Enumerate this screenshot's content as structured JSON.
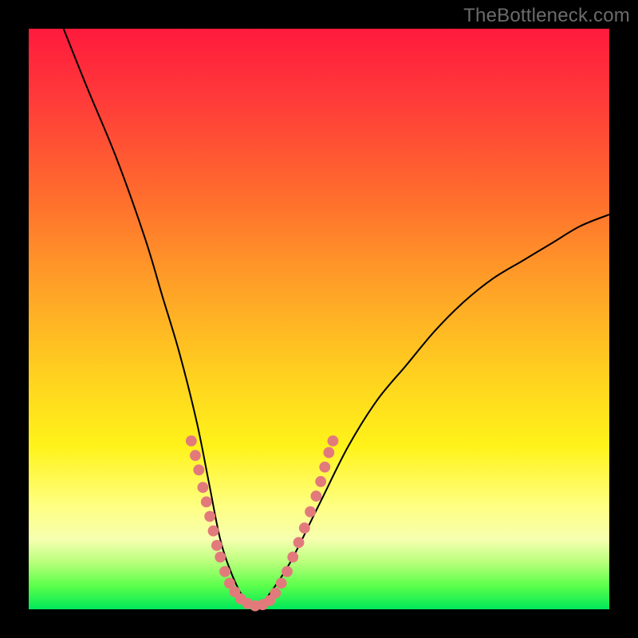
{
  "watermark": "TheBottleneck.com",
  "colors": {
    "curve": "#000000",
    "marker": "#e27a7c",
    "background_black": "#000000"
  },
  "chart_data": {
    "type": "line",
    "title": "",
    "xlabel": "",
    "ylabel": "",
    "xlim": [
      0,
      100
    ],
    "ylim": [
      0,
      100
    ],
    "grid": false,
    "legend": false,
    "series": [
      {
        "name": "bottleneck-curve",
        "x": [
          6,
          10,
          15,
          20,
          23,
          26,
          29,
          31,
          33,
          35,
          37,
          39,
          41,
          45,
          50,
          55,
          60,
          65,
          70,
          75,
          80,
          85,
          90,
          95,
          100
        ],
        "y": [
          100,
          90,
          78,
          64,
          54,
          44,
          32,
          22,
          12,
          6,
          2,
          0,
          2,
          8,
          18,
          28,
          36,
          42,
          48,
          53,
          57,
          60,
          63,
          66,
          68
        ]
      }
    ],
    "markers": [
      {
        "name": "highlight-dots",
        "points": [
          {
            "x": 28.0,
            "y": 29.0
          },
          {
            "x": 28.7,
            "y": 26.5
          },
          {
            "x": 29.3,
            "y": 24.0
          },
          {
            "x": 30.0,
            "y": 21.0
          },
          {
            "x": 30.6,
            "y": 18.5
          },
          {
            "x": 31.2,
            "y": 16.0
          },
          {
            "x": 31.8,
            "y": 13.5
          },
          {
            "x": 32.4,
            "y": 11.0
          },
          {
            "x": 33.0,
            "y": 9.0
          },
          {
            "x": 33.8,
            "y": 6.5
          },
          {
            "x": 34.6,
            "y": 4.5
          },
          {
            "x": 35.5,
            "y": 3.0
          },
          {
            "x": 36.5,
            "y": 1.8
          },
          {
            "x": 37.7,
            "y": 1.0
          },
          {
            "x": 39.0,
            "y": 0.6
          },
          {
            "x": 40.3,
            "y": 0.8
          },
          {
            "x": 41.5,
            "y": 1.5
          },
          {
            "x": 42.5,
            "y": 2.8
          },
          {
            "x": 43.5,
            "y": 4.5
          },
          {
            "x": 44.5,
            "y": 6.5
          },
          {
            "x": 45.5,
            "y": 9.0
          },
          {
            "x": 46.5,
            "y": 11.5
          },
          {
            "x": 47.5,
            "y": 14.0
          },
          {
            "x": 48.5,
            "y": 16.8
          },
          {
            "x": 49.5,
            "y": 19.5
          },
          {
            "x": 50.3,
            "y": 22.0
          },
          {
            "x": 51.0,
            "y": 24.5
          },
          {
            "x": 51.7,
            "y": 27.0
          },
          {
            "x": 52.4,
            "y": 29.0
          }
        ]
      }
    ]
  }
}
